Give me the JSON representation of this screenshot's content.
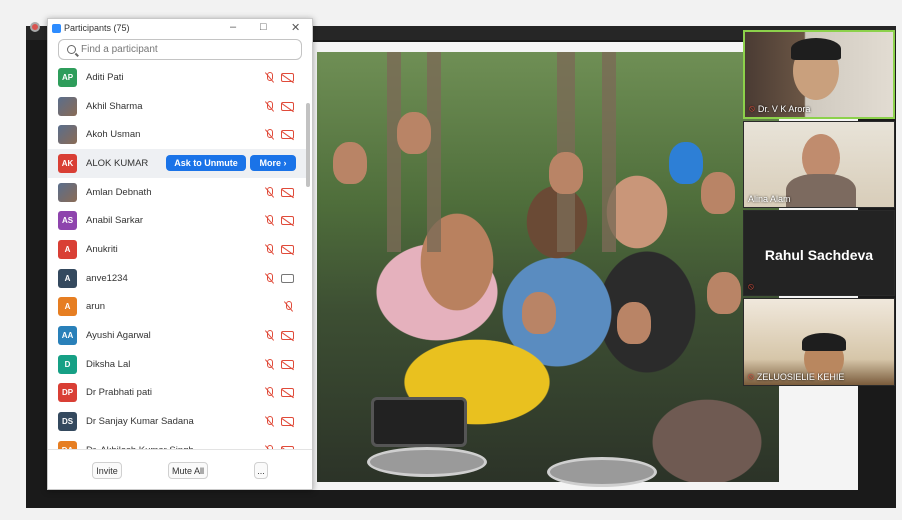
{
  "panel": {
    "title": "Participants (75)",
    "window_controls": [
      "–",
      "□",
      "✕"
    ],
    "search_placeholder": "Find a participant",
    "participants": [
      {
        "initials": "AP",
        "name": "Aditi Pati",
        "avatar_color": "#2e9d5b",
        "photo": false,
        "mic": "muted",
        "video": "off"
      },
      {
        "initials": "",
        "name": "Akhil Sharma",
        "avatar_color": "",
        "photo": true,
        "mic": "muted",
        "video": "off"
      },
      {
        "initials": "",
        "name": "Akoh Usman",
        "avatar_color": "",
        "photo": true,
        "mic": "muted",
        "video": "off"
      },
      {
        "initials": "AK",
        "name": "ALOK KUMAR",
        "avatar_color": "#d93f35",
        "photo": false,
        "hover": true,
        "buttons": [
          "Ask to Unmute",
          "More ›"
        ]
      },
      {
        "initials": "",
        "name": "Amlan Debnath",
        "avatar_color": "",
        "photo": true,
        "mic": "muted",
        "video": "off"
      },
      {
        "initials": "AS",
        "name": "Anabil Sarkar",
        "avatar_color": "#8e44ad",
        "photo": false,
        "mic": "muted",
        "video": "off"
      },
      {
        "initials": "A",
        "name": "Anukriti",
        "avatar_color": "#d93f35",
        "photo": false,
        "mic": "muted",
        "video": "off"
      },
      {
        "initials": "A",
        "name": "anve1234",
        "avatar_color": "#34495e",
        "photo": false,
        "mic": "muted",
        "video": "on"
      },
      {
        "initials": "A",
        "name": "arun",
        "avatar_color": "#e67e22",
        "photo": false,
        "mic": "muted",
        "video": "none"
      },
      {
        "initials": "AA",
        "name": "Ayushi Agarwal",
        "avatar_color": "#2980b9",
        "photo": false,
        "mic": "muted",
        "video": "off"
      },
      {
        "initials": "D",
        "name": "Diksha Lal",
        "avatar_color": "#16a085",
        "photo": false,
        "mic": "muted",
        "video": "off"
      },
      {
        "initials": "DP",
        "name": "Dr Prabhati pati",
        "avatar_color": "#d93f35",
        "photo": false,
        "mic": "muted",
        "video": "off"
      },
      {
        "initials": "DS",
        "name": "Dr Sanjay Kumar Sadana",
        "avatar_color": "#34495e",
        "photo": false,
        "mic": "muted",
        "video": "off"
      },
      {
        "initials": "DA",
        "name": "Dr. Akhilesh Kumar Singh",
        "avatar_color": "#e67e22",
        "photo": false,
        "mic": "muted",
        "video": "off"
      }
    ],
    "footer": {
      "invite": "Invite",
      "mute_all": "Mute All",
      "more": "..."
    }
  },
  "gallery": [
    {
      "name": "Dr. V K Arora",
      "mic": "muted",
      "active_speaker": true
    },
    {
      "name": "Alina Alam",
      "mic": "on"
    },
    {
      "name": "Rahul Sachdeva",
      "mic": "muted",
      "video": "off"
    },
    {
      "name": "ZELUOSIELIE KEHIE",
      "mic": "muted"
    }
  ],
  "colors": {
    "accent": "#1a73e8",
    "muted_red": "#e04b3a",
    "active_speaker": "#8cd14b"
  }
}
